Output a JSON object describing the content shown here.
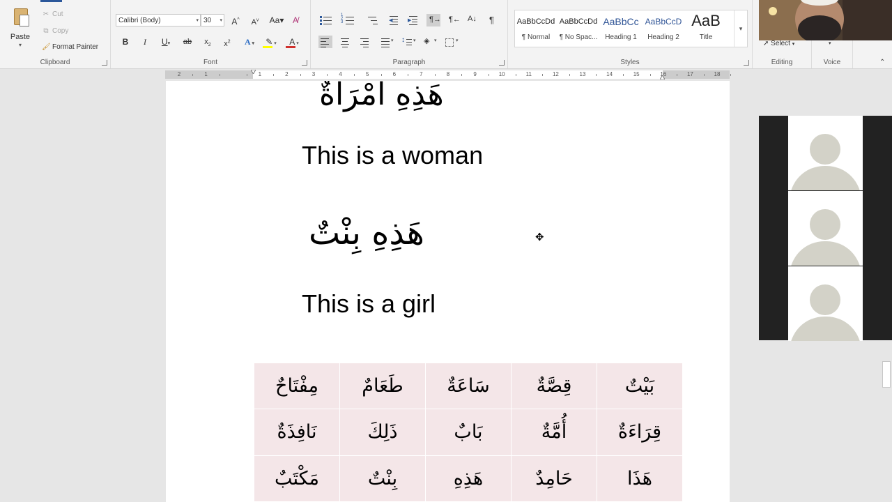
{
  "ribbon": {
    "clipboard": {
      "paste_label": "Paste",
      "cut_label": "Cut",
      "copy_label": "Copy",
      "format_painter_label": "Format Painter",
      "group_label": "Clipboard"
    },
    "font": {
      "font_name": "Calibri (Body)",
      "font_size": "30",
      "group_label": "Font",
      "highlight_color": "#ffff00",
      "font_color": "#d0312d"
    },
    "paragraph": {
      "group_label": "Paragraph"
    },
    "styles": {
      "group_label": "Styles",
      "items": [
        {
          "preview": "AaBbCcDd",
          "name": "¶ Normal"
        },
        {
          "preview": "AaBbCcDd",
          "name": "¶ No Spac..."
        },
        {
          "preview": "AaBbCc",
          "name": "Heading 1"
        },
        {
          "preview": "AaBbCcD",
          "name": "Heading 2"
        },
        {
          "preview": "AaB",
          "name": "Title"
        }
      ]
    },
    "editing": {
      "select_label": "Select",
      "group_label": "Editing"
    },
    "voice": {
      "group_label": "Voice"
    }
  },
  "ruler": {
    "numbers": [
      "2",
      "1",
      "",
      "1",
      "2",
      "3",
      "4",
      "5",
      "6",
      "7",
      "8",
      "9",
      "10",
      "11",
      "12",
      "13",
      "14",
      "15",
      "16",
      "17",
      "18"
    ]
  },
  "document": {
    "arabic_1": "هَذِهِ امْرَأَةٌ",
    "english_1": "This is a woman",
    "arabic_2": "هَذِهِ بِنْتٌ",
    "english_2": "This is a girl",
    "vocab_table": [
      [
        "بَيْتٌ",
        "قِصَّةٌ",
        "سَاعَةٌ",
        "طَعَامٌ",
        "مِفْتَاحٌ"
      ],
      [
        "قِرَاءَةٌ",
        "أُمَّةٌ",
        "بَابٌ",
        "ذَلِكَ",
        "نَافِذَةٌ"
      ],
      [
        "هَذَا",
        "حَامِدٌ",
        "هَذِهِ",
        "بِنْتٌ",
        "مَكْتَبٌ"
      ]
    ]
  },
  "colors": {
    "accent": "#2b579a",
    "table_bg": "#f4e6e8"
  }
}
